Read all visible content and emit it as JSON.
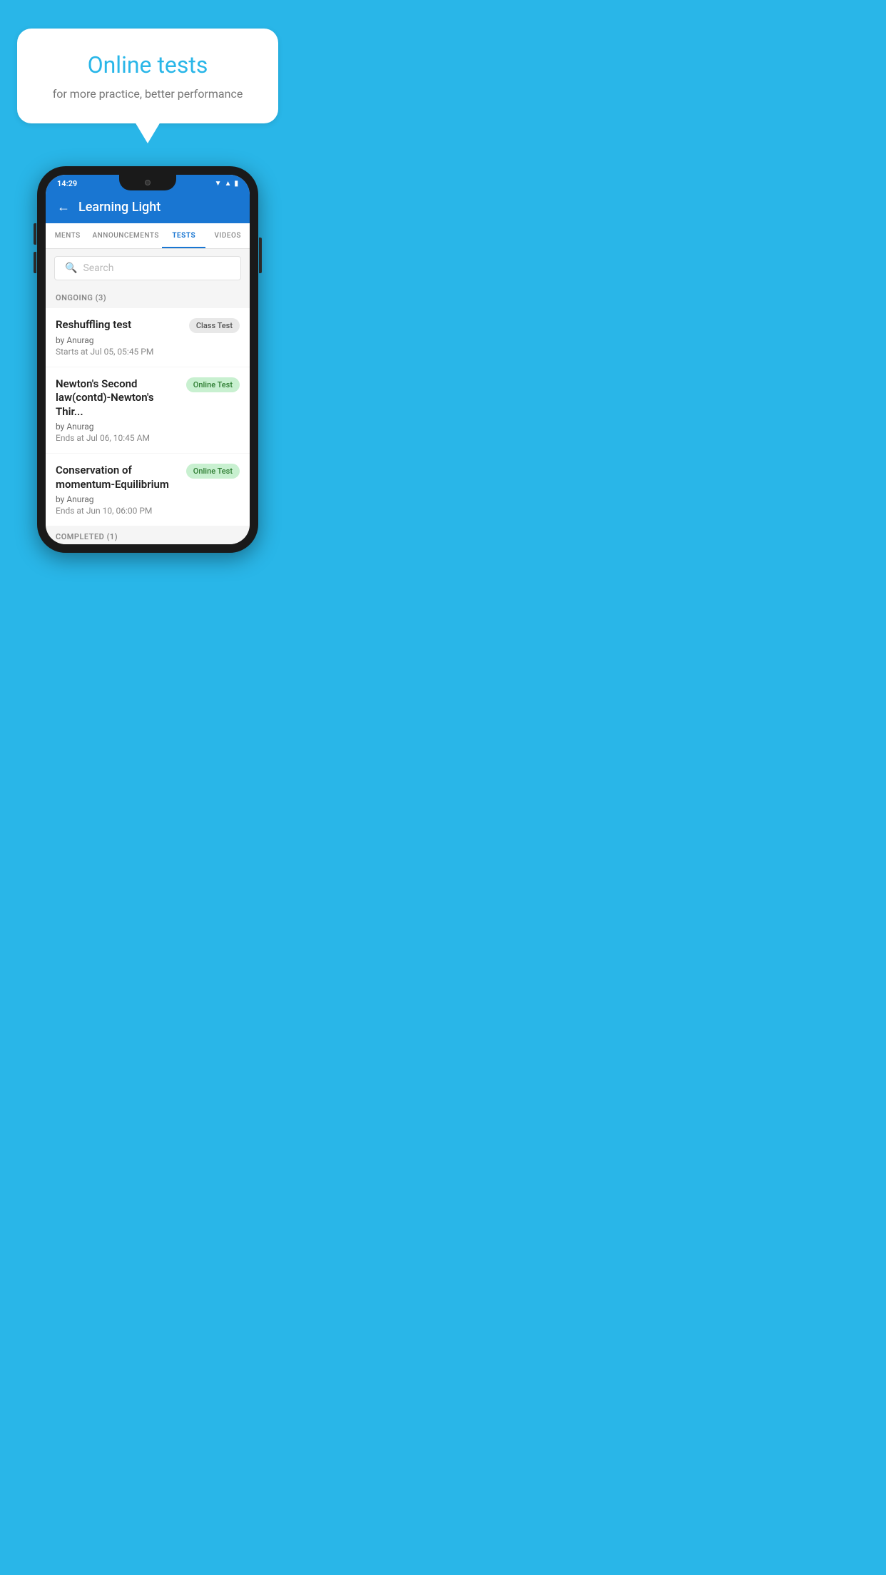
{
  "hero": {
    "title": "Online tests",
    "subtitle": "for more practice, better performance"
  },
  "phone": {
    "status_bar": {
      "time": "14:29",
      "icons": [
        "wifi",
        "signal",
        "battery"
      ]
    },
    "app_bar": {
      "title": "Learning Light",
      "back_label": "←"
    },
    "tabs": [
      {
        "label": "MENTS",
        "active": false
      },
      {
        "label": "ANNOUNCEMENTS",
        "active": false
      },
      {
        "label": "TESTS",
        "active": true
      },
      {
        "label": "VIDEOS",
        "active": false
      }
    ],
    "search": {
      "placeholder": "Search"
    },
    "ongoing_section": {
      "header": "ONGOING (3)",
      "tests": [
        {
          "title": "Reshuffling test",
          "author": "by Anurag",
          "date": "Starts at  Jul 05, 05:45 PM",
          "badge": "Class Test",
          "badge_type": "class"
        },
        {
          "title": "Newton's Second law(contd)-Newton's Thir...",
          "author": "by Anurag",
          "date": "Ends at  Jul 06, 10:45 AM",
          "badge": "Online Test",
          "badge_type": "online"
        },
        {
          "title": "Conservation of momentum-Equilibrium",
          "author": "by Anurag",
          "date": "Ends at  Jun 10, 06:00 PM",
          "badge": "Online Test",
          "badge_type": "online"
        }
      ]
    },
    "completed_section": {
      "header": "COMPLETED (1)"
    }
  }
}
